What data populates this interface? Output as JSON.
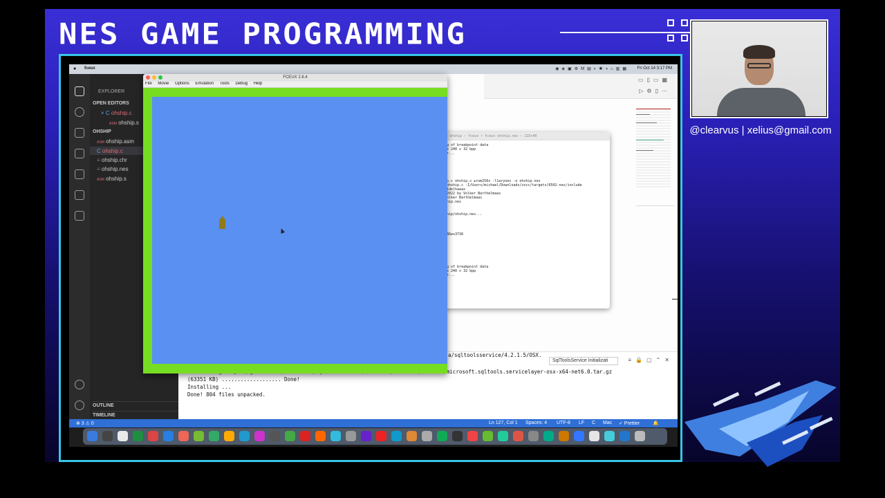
{
  "show": {
    "title": "NES GAME PROGRAMMING",
    "handle": "@clearvus | xelius@gmail.com"
  },
  "menubar": {
    "app_name": "fceux",
    "clock": "Fri Oct 14  3:17 PM"
  },
  "fceux": {
    "window_title": "FCEUX 2.6.4",
    "menu": [
      "File",
      "Movie",
      "Options",
      "Emulation",
      "Tools",
      "Debug",
      "Help"
    ],
    "colors": {
      "border": "#77dd22",
      "field": "#5a90f2",
      "sprite": "#8e7a1b"
    }
  },
  "vscode": {
    "explorer_label": "EXPLORER",
    "open_editors_label": "OPEN EDITORS",
    "open_editors": [
      {
        "icon": "×  C",
        "name": "ohship.c"
      },
      {
        "icon": "ASM",
        "name": "ohship.s"
      }
    ],
    "project_label": "OHSHIP",
    "files": [
      {
        "icon": "ASM",
        "name": "ohship.asm"
      },
      {
        "icon": "C",
        "name": "ohship.c"
      },
      {
        "icon": "≡",
        "name": "ohship.chr"
      },
      {
        "icon": "≡",
        "name": "ohship.nes"
      },
      {
        "icon": "ASM",
        "name": "ohship.s"
      }
    ],
    "outline_label": "OUTLINE",
    "timeline_label": "TIMELINE",
    "output_source": "SqlToolsService Initializati",
    "panel_lines": [
      "Downloading https://github.com/Microsoft/sqltoolsservice/releases/download/4.2.1.5/microsoft.sqltools.servicelayer-osx-x64-net6.0.tar.gz",
      "(63351 KB) ................... Done!",
      "Installing ...",
      "Done! 804 files unpacked."
    ],
    "panel_partial": "a/sqltoolsservice/4.2.1.5/OSX.",
    "status_left": "⊗ 3 ⚠ 0",
    "status_right": [
      "Ln 127, Col 1",
      "Spaces: 4",
      "UTF-8",
      "LF",
      "C",
      "Mac",
      "✓ Prettier"
    ]
  },
  "terminal": {
    "title": "ohship — fceux • fceux ohship.nes — 115×40",
    "lines": [
      "g of breakpoint data",
      "x 240 x 32 bpp",
      "r...",
      "p.c ohship.s ±rom256x -l1aryoes -o ohship.nes",
      "ohship.c -I/Users/michael/Downloads/vscc/targets/6502-nes/include",
      "ldelhaaas",
      "2022 by Volker Barthelmaas",
      "olker Barthelmaas",
      "hip.nes",
      "hip/ohship.nes...",
      "36ex3736",
      "g of breakpoint data",
      "x 240 x 32 bpp",
      "r..."
    ]
  }
}
